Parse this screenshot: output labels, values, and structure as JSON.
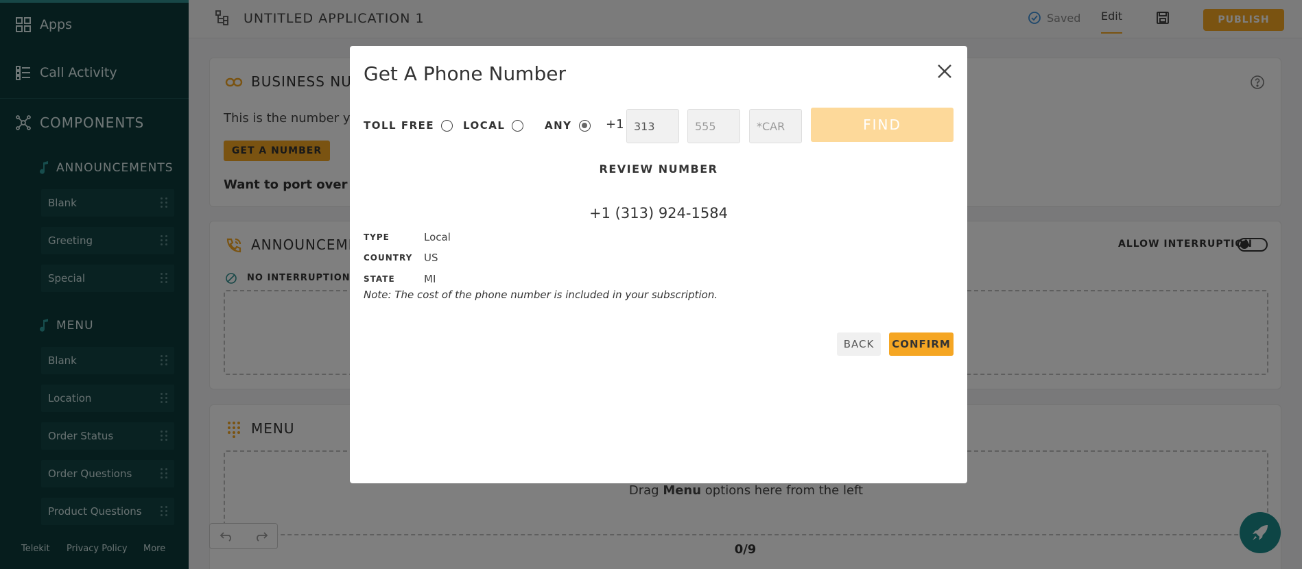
{
  "sidebar": {
    "nav": [
      {
        "label": "Apps",
        "icon": "grid-icon"
      },
      {
        "label": "Call Activity",
        "icon": "list-icon"
      }
    ],
    "components_label": "COMPONENTS",
    "announcements": {
      "label": "ANNOUNCEMENTS",
      "items": [
        "Blank",
        "Greeting",
        "Special"
      ]
    },
    "menu": {
      "label": "MENU",
      "items": [
        "Blank",
        "Location",
        "Order Status",
        "Order Questions",
        "Product Questions"
      ]
    },
    "footer": [
      "Telekit",
      "Privacy Policy",
      "More"
    ]
  },
  "topbar": {
    "title": "UNTITLED APPLICATION 1",
    "saved": "Saved",
    "edit": "Edit",
    "publish": "PUBLISH"
  },
  "cards": {
    "business_number": {
      "title": "BUSINESS NUM",
      "text": "This is the number yo",
      "button": "GET A NUMBER",
      "port": "Want to port over a p"
    },
    "announcements": {
      "title": "ANNOUNCEME",
      "no_interruption": "NO INTERRUPTION",
      "allow_interruption": "ALLOW INTERRUPTION"
    },
    "menu": {
      "title": "MENU",
      "drag_prefix": "Drag ",
      "drag_bold": "Menu",
      "drag_suffix": " options here from the left",
      "count": "0/9"
    }
  },
  "modal": {
    "title": "Get A Phone Number",
    "radios": [
      {
        "label": "TOLL FREE",
        "selected": false
      },
      {
        "label": "LOCAL",
        "selected": false
      },
      {
        "label": "ANY",
        "selected": true
      }
    ],
    "country_code": "+1",
    "area_code": "313",
    "prefix_placeholder": "555",
    "suffix_placeholder": "*CAR",
    "find": "FIND",
    "review_heading": "REVIEW NUMBER",
    "phone_number": "+1 (313) 924-1584",
    "details": [
      {
        "key": "TYPE",
        "value": "Local"
      },
      {
        "key": "COUNTRY",
        "value": "US"
      },
      {
        "key": "STATE",
        "value": "MI"
      }
    ],
    "note": "Note: The cost of the phone number is included in your subscription.",
    "back": "BACK",
    "confirm": "CONFIRM"
  },
  "colors": {
    "sidebar": "#0c3a3a",
    "accent": "#f5a623",
    "find_disabled": "#fdd99a"
  }
}
